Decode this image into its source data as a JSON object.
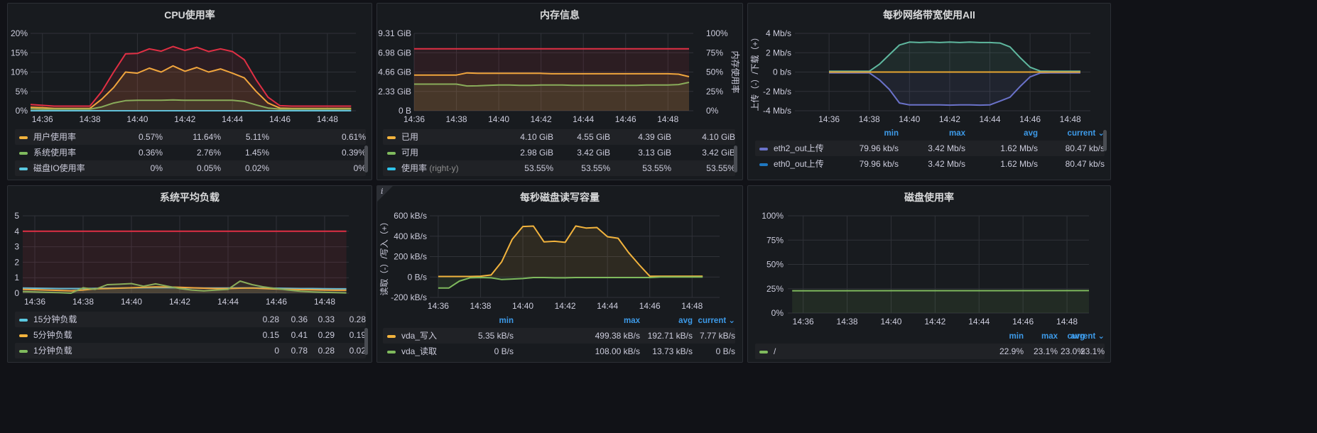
{
  "panels": {
    "cpu": {
      "title": "CPU使用率",
      "legend": [
        {
          "name": "用户使用率",
          "color": "#f2b33d",
          "values": [
            "0.57%",
            "11.64%",
            "5.11%",
            "0.61%"
          ]
        },
        {
          "name": "系统使用率",
          "color": "#7fba5d",
          "values": [
            "0.36%",
            "2.76%",
            "1.45%",
            "0.39%"
          ]
        },
        {
          "name": "磁盘IO使用率",
          "color": "#5ac8e0",
          "values": [
            "0%",
            "0.05%",
            "0.02%",
            "0%"
          ]
        }
      ]
    },
    "memory": {
      "title": "内存信息",
      "legend": [
        {
          "name": "已用",
          "suffix": "",
          "color": "#f2b33d",
          "values": [
            "4.10 GiB",
            "4.55 GiB",
            "4.39 GiB",
            "4.10 GiB"
          ]
        },
        {
          "name": "可用",
          "suffix": "",
          "color": "#7fba5d",
          "values": [
            "2.98 GiB",
            "3.42 GiB",
            "3.13 GiB",
            "3.42 GiB"
          ]
        },
        {
          "name": "使用率",
          "suffix": "(right-y)",
          "color": "#2ec3ea",
          "values": [
            "53.55%",
            "53.55%",
            "53.55%",
            "53.55%"
          ]
        }
      ]
    },
    "network": {
      "title": "每秒网络带宽使用All",
      "headers": [
        "min",
        "max",
        "avg",
        "current ⌄"
      ],
      "legend": [
        {
          "name": "eth2_out上传",
          "color": "#6a72c9",
          "values": [
            "79.96 kb/s",
            "3.42 Mb/s",
            "1.62 Mb/s",
            "80.47 kb/s"
          ]
        },
        {
          "name": "eth0_out上传",
          "color": "#1f78c1",
          "values": [
            "79.96 kb/s",
            "3.42 Mb/s",
            "1.62 Mb/s",
            "80.47 kb/s"
          ]
        }
      ]
    },
    "load": {
      "title": "系统平均负载",
      "legend": [
        {
          "name": "15分钟负载",
          "color": "#5ac8e0",
          "values": [
            "0.28",
            "0.36",
            "0.33",
            "0.28"
          ]
        },
        {
          "name": "5分钟负载",
          "color": "#f2b33d",
          "values": [
            "0.15",
            "0.41",
            "0.29",
            "0.19"
          ]
        },
        {
          "name": "1分钟负载",
          "color": "#7fba5d",
          "values": [
            "0",
            "0.78",
            "0.28",
            "0.02"
          ]
        }
      ]
    },
    "disk_io": {
      "title": "每秒磁盘读写容量",
      "info_icon": "i",
      "headers": [
        "min",
        "max",
        "avg",
        "current ⌄"
      ],
      "legend": [
        {
          "name": "vda_写入",
          "color": "#f2b33d",
          "values": [
            "5.35 kB/s",
            "499.38 kB/s",
            "192.71 kB/s",
            "7.77 kB/s"
          ]
        },
        {
          "name": "vda_读取",
          "color": "#7fba5d",
          "values": [
            "0 B/s",
            "108.00 kB/s",
            "13.73 kB/s",
            "0 B/s"
          ]
        }
      ]
    },
    "disk_usage": {
      "title": "磁盘使用率",
      "headers": [
        "min",
        "max",
        "avg",
        "current ⌄"
      ],
      "legend": [
        {
          "name": "/",
          "color": "#7fba5d",
          "values": [
            "22.9%",
            "23.1%",
            "23.0%",
            "23.1%"
          ]
        }
      ]
    }
  },
  "chart_data": [
    {
      "panel": "cpu",
      "type": "line",
      "x_ticks": [
        "14:36",
        "14:38",
        "14:40",
        "14:42",
        "14:44",
        "14:46",
        "14:48"
      ],
      "y_ticks": [
        "0%",
        "5%",
        "10%",
        "15%",
        "20%"
      ],
      "ylim": [
        0,
        20
      ],
      "x": [
        35.5,
        36,
        36.5,
        37,
        37.5,
        38,
        38.5,
        39,
        39.5,
        40,
        40.5,
        41,
        41.5,
        42,
        42.5,
        43,
        43.5,
        44,
        44.5,
        45,
        45.5,
        46,
        46.5,
        47,
        47.5,
        48,
        48.5,
        49
      ],
      "series": [
        {
          "name": "用户使用率",
          "color": "#f2b33d",
          "values": [
            0.9,
            0.8,
            0.6,
            0.6,
            0.6,
            0.6,
            3,
            6,
            10,
            9.7,
            11,
            10,
            11.6,
            10.2,
            11.2,
            10,
            10.8,
            9.7,
            8.5,
            5,
            2,
            0.7,
            0.6,
            0.6,
            0.6,
            0.6,
            0.6,
            0.6
          ]
        },
        {
          "name": "系统使用率",
          "color": "#7fba5d",
          "values": [
            0.5,
            0.4,
            0.4,
            0.4,
            0.4,
            0.4,
            1,
            2,
            2.6,
            2.7,
            2.7,
            2.7,
            2.8,
            2.7,
            2.7,
            2.7,
            2.7,
            2.7,
            2.4,
            1.5,
            0.7,
            0.4,
            0.4,
            0.4,
            0.4,
            0.4,
            0.4,
            0.4
          ]
        },
        {
          "name": "磁盘IO使用率",
          "color": "#5ac8e0",
          "values": [
            0,
            0,
            0,
            0,
            0,
            0,
            0,
            0,
            0,
            0,
            0,
            0,
            0,
            0,
            0,
            0,
            0,
            0,
            0,
            0,
            0,
            0,
            0,
            0,
            0,
            0,
            0,
            0
          ]
        },
        {
          "name": "",
          "color": "#e02f44",
          "values": [
            1.6,
            1.4,
            1.2,
            1.2,
            1.2,
            1.2,
            5,
            10,
            14.7,
            14.8,
            16,
            15.4,
            16.6,
            15.6,
            16.4,
            15.3,
            16,
            15.3,
            13.2,
            8,
            3.5,
            1.3,
            1.2,
            1.2,
            1.2,
            1.2,
            1.2,
            1.2
          ]
        }
      ]
    },
    {
      "panel": "memory",
      "type": "line",
      "x_ticks": [
        "14:36",
        "14:38",
        "14:40",
        "14:42",
        "14:44",
        "14:46",
        "14:48"
      ],
      "y_ticks": [
        "0 B",
        "2.33 GiB",
        "4.66 GiB",
        "6.98 GiB",
        "9.31 GiB"
      ],
      "y_right_ticks": [
        "0%",
        "25%",
        "50%",
        "75%",
        "100%"
      ],
      "y_right_label": "内存使用率",
      "ylim": [
        0,
        9.31
      ],
      "x": [
        36,
        36.5,
        37,
        37.5,
        38,
        38.5,
        39,
        39.5,
        40,
        40.5,
        41,
        41.5,
        42,
        42.5,
        43,
        43.5,
        44,
        44.5,
        45,
        45.5,
        46,
        46.5,
        47,
        47.5,
        48,
        48.5,
        49
      ],
      "series": [
        {
          "name": "已用",
          "color": "#f2b33d",
          "values": [
            4.3,
            4.3,
            4.3,
            4.3,
            4.3,
            4.55,
            4.5,
            4.5,
            4.5,
            4.5,
            4.5,
            4.5,
            4.5,
            4.45,
            4.45,
            4.45,
            4.45,
            4.45,
            4.45,
            4.45,
            4.45,
            4.45,
            4.45,
            4.45,
            4.45,
            4.4,
            4.1
          ]
        },
        {
          "name": "可用",
          "color": "#7fba5d",
          "values": [
            3.2,
            3.2,
            3.2,
            3.2,
            3.2,
            2.98,
            3.0,
            3.05,
            3.1,
            3.1,
            3.05,
            3.05,
            3.1,
            3.1,
            3.1,
            3.05,
            3.05,
            3.05,
            3.05,
            3.05,
            3.05,
            3.05,
            3.1,
            3.1,
            3.1,
            3.15,
            3.42
          ]
        },
        {
          "name": "",
          "color": "#e02f44",
          "values": [
            7.45,
            7.45,
            7.45,
            7.45,
            7.45,
            7.45,
            7.45,
            7.45,
            7.45,
            7.45,
            7.45,
            7.45,
            7.45,
            7.45,
            7.45,
            7.45,
            7.45,
            7.45,
            7.45,
            7.45,
            7.45,
            7.45,
            7.45,
            7.45,
            7.45,
            7.45,
            7.45
          ]
        }
      ]
    },
    {
      "panel": "network",
      "type": "area",
      "x_ticks": [
        "14:36",
        "14:38",
        "14:40",
        "14:42",
        "14:44",
        "14:46",
        "14:48"
      ],
      "y_ticks": [
        "-4 Mb/s",
        "-2 Mb/s",
        "0 b/s",
        "2 Mb/s",
        "4 Mb/s"
      ],
      "y_label": "上传（-）/下载（+）",
      "ylim": [
        -4,
        4
      ],
      "x": [
        36,
        36.5,
        37,
        37.5,
        38,
        38.5,
        39,
        39.5,
        40,
        40.5,
        41,
        41.5,
        42,
        42.5,
        43,
        43.5,
        44,
        44.5,
        45,
        45.5,
        46,
        46.5,
        47,
        47.5,
        48,
        48.5
      ],
      "series": [
        {
          "name": "",
          "color": "#5fb89f",
          "values": [
            0.08,
            0.08,
            0.08,
            0.08,
            0.08,
            0.8,
            1.8,
            2.8,
            3.1,
            3.05,
            3.1,
            3.05,
            3.1,
            3.05,
            3.1,
            3.05,
            3.05,
            3.0,
            2.6,
            1.5,
            0.5,
            0.1,
            0.08,
            0.08,
            0.08,
            0.08
          ]
        },
        {
          "name": "eth2_out上传",
          "color": "#6a72c9",
          "values": [
            -0.08,
            -0.08,
            -0.08,
            -0.08,
            -0.08,
            -0.8,
            -1.8,
            -3.2,
            -3.4,
            -3.4,
            -3.4,
            -3.4,
            -3.42,
            -3.4,
            -3.4,
            -3.42,
            -3.4,
            -3.0,
            -2.6,
            -1.5,
            -0.5,
            -0.1,
            -0.08,
            -0.08,
            -0.08,
            -0.08
          ]
        },
        {
          "name": "",
          "color": "#e6a530",
          "values": [
            0,
            0,
            0,
            0,
            0,
            0,
            0,
            0,
            0,
            0,
            0,
            0,
            0,
            0,
            0,
            0,
            0,
            0,
            0,
            0,
            0,
            0,
            0,
            0,
            0,
            0
          ]
        }
      ]
    },
    {
      "panel": "load",
      "type": "line",
      "x_ticks": [
        "14:36",
        "14:38",
        "14:40",
        "14:42",
        "14:44",
        "14:46",
        "14:48"
      ],
      "y_ticks": [
        "0",
        "1",
        "2",
        "3",
        "4",
        "5"
      ],
      "ylim": [
        0,
        5
      ],
      "x": [
        35.5,
        36,
        36.5,
        37,
        37.5,
        38,
        38.5,
        39,
        39.5,
        40,
        40.5,
        41,
        41.5,
        42,
        42.5,
        43,
        43.5,
        44,
        44.5,
        45,
        45.5,
        46,
        46.5,
        47,
        47.5,
        48,
        48.5,
        48.9
      ],
      "series": [
        {
          "name": "15分钟负载",
          "color": "#5ac8e0",
          "values": [
            0.33,
            0.32,
            0.31,
            0.3,
            0.3,
            0.3,
            0.31,
            0.32,
            0.33,
            0.34,
            0.35,
            0.36,
            0.36,
            0.35,
            0.34,
            0.33,
            0.33,
            0.33,
            0.34,
            0.34,
            0.33,
            0.32,
            0.31,
            0.3,
            0.3,
            0.29,
            0.28,
            0.28
          ]
        },
        {
          "name": "5分钟负载",
          "color": "#f2b33d",
          "values": [
            0.25,
            0.23,
            0.2,
            0.18,
            0.15,
            0.2,
            0.28,
            0.3,
            0.32,
            0.35,
            0.38,
            0.41,
            0.4,
            0.38,
            0.35,
            0.32,
            0.3,
            0.3,
            0.32,
            0.33,
            0.3,
            0.27,
            0.25,
            0.23,
            0.22,
            0.2,
            0.19,
            0.19
          ]
        },
        {
          "name": "1分钟负载",
          "color": "#7fba5d",
          "values": [
            0.1,
            0.08,
            0.05,
            0.03,
            0.0,
            0.35,
            0.25,
            0.55,
            0.58,
            0.62,
            0.45,
            0.6,
            0.45,
            0.3,
            0.2,
            0.15,
            0.2,
            0.25,
            0.78,
            0.55,
            0.4,
            0.3,
            0.2,
            0.12,
            0.08,
            0.05,
            0.03,
            0.02
          ]
        },
        {
          "name": "",
          "color": "#e02f44",
          "values": [
            4,
            4,
            4,
            4,
            4,
            4,
            4,
            4,
            4,
            4,
            4,
            4,
            4,
            4,
            4,
            4,
            4,
            4,
            4,
            4,
            4,
            4,
            4,
            4,
            4,
            4,
            4,
            4
          ]
        }
      ]
    },
    {
      "panel": "disk_io",
      "type": "line",
      "x_ticks": [
        "14:36",
        "14:38",
        "14:40",
        "14:42",
        "14:44",
        "14:46",
        "14:48"
      ],
      "y_ticks": [
        "-200 kB/s",
        "0 B/s",
        "200 kB/s",
        "400 kB/s",
        "600 kB/s"
      ],
      "y_label": "读取（-）/写入（+）",
      "ylim": [
        -200,
        600
      ],
      "x": [
        36,
        36.5,
        37,
        37.5,
        38,
        38.5,
        39,
        39.5,
        40,
        40.5,
        41,
        41.5,
        42,
        42.5,
        43,
        43.5,
        44,
        44.5,
        45,
        45.5,
        46,
        46.5,
        47,
        47.5,
        48,
        48.5
      ],
      "series": [
        {
          "name": "vda_写入",
          "color": "#f2b33d",
          "values": [
            5,
            5,
            5,
            5,
            8,
            20,
            150,
            370,
            495,
            499,
            345,
            350,
            340,
            500,
            480,
            485,
            395,
            380,
            240,
            120,
            8,
            8,
            8,
            8,
            8,
            8
          ]
        },
        {
          "name": "vda_读取",
          "color": "#7fba5d",
          "values": [
            -108,
            -108,
            -40,
            -8,
            -5,
            -8,
            -25,
            -20,
            -15,
            -5,
            -5,
            -8,
            -8,
            -5,
            -5,
            -5,
            -5,
            -5,
            -5,
            -5,
            -5,
            0,
            0,
            0,
            0,
            0
          ]
        }
      ]
    },
    {
      "panel": "disk_usage",
      "type": "line",
      "x_ticks": [
        "14:36",
        "14:38",
        "14:40",
        "14:42",
        "14:44",
        "14:46",
        "14:48"
      ],
      "y_ticks": [
        "0%",
        "25%",
        "50%",
        "75%",
        "100%"
      ],
      "ylim": [
        0,
        100
      ],
      "x": [
        35.5,
        49
      ],
      "series": [
        {
          "name": "/",
          "color": "#7fba5d",
          "values": [
            22.9,
            23.1
          ]
        }
      ]
    }
  ]
}
